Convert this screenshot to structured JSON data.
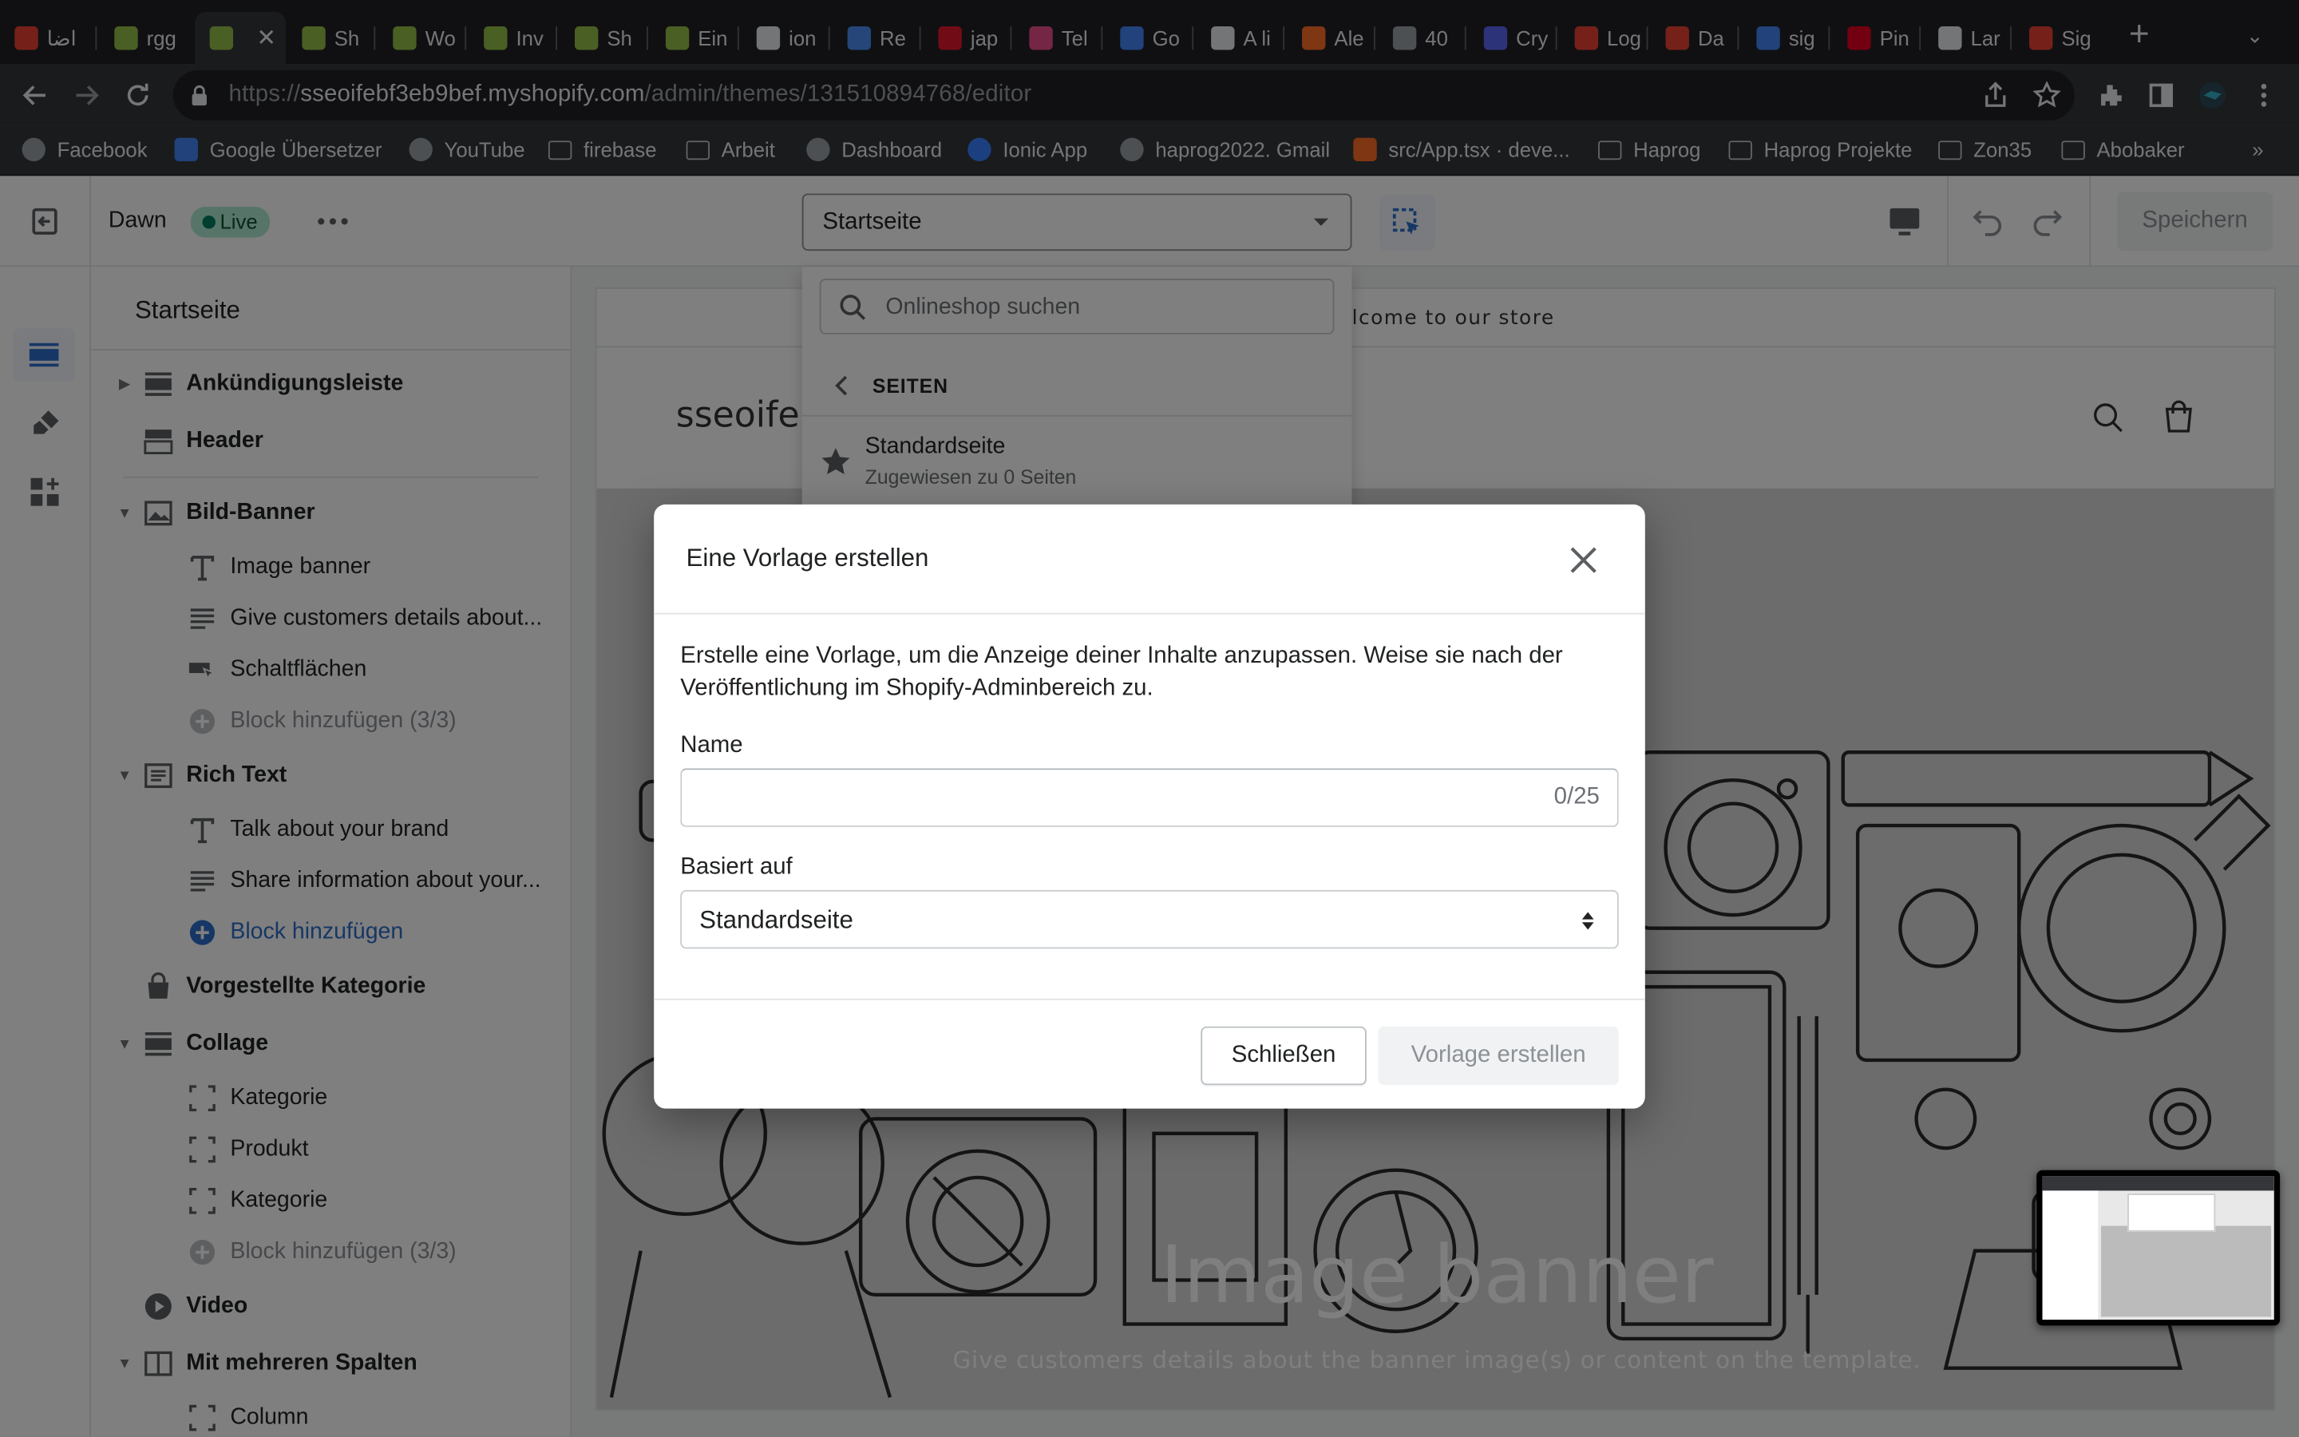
{
  "browser": {
    "tabs": [
      {
        "label": "اضا",
        "icon": "gmail-like-icon",
        "color": "#ea4335"
      },
      {
        "label": "rgg",
        "icon": "shopify-icon",
        "color": "#95bf47"
      },
      {
        "label": "",
        "icon": "shopify-icon",
        "color": "#95bf47",
        "active": true
      },
      {
        "label": "Sh",
        "icon": "shopify-icon",
        "color": "#95bf47"
      },
      {
        "label": "Wo",
        "icon": "shopify-icon",
        "color": "#95bf47"
      },
      {
        "label": "Inv",
        "icon": "shopify-icon",
        "color": "#95bf47"
      },
      {
        "label": "Sh",
        "icon": "shopify-icon",
        "color": "#95bf47"
      },
      {
        "label": "Ein",
        "icon": "shopify-icon",
        "color": "#95bf47"
      },
      {
        "label": "ion",
        "icon": "github-icon",
        "color": "#e8eaed"
      },
      {
        "label": "Re",
        "icon": "redux-icon",
        "color": "#4c8df5"
      },
      {
        "label": "jap",
        "icon": "notion-red-icon",
        "color": "#e2192c"
      },
      {
        "label": "Tel",
        "icon": "dribbble-icon",
        "color": "#ea4c89"
      },
      {
        "label": "Go",
        "icon": "google-translate-icon",
        "color": "#4285f4"
      },
      {
        "label": "A li",
        "icon": "github-icon",
        "color": "#e8eaed"
      },
      {
        "label": "Ale",
        "icon": "gitlab-icon",
        "color": "#fc6d26"
      },
      {
        "label": "40",
        "icon": "globe-icon",
        "color": "#9aa0a6"
      },
      {
        "label": "Cry",
        "icon": "crypto-icon",
        "color": "#5a67f2"
      },
      {
        "label": "Log",
        "icon": "app-red-icon",
        "color": "#ea4335"
      },
      {
        "label": "Da",
        "icon": "app-red-icon",
        "color": "#ea4335"
      },
      {
        "label": "sig",
        "icon": "google-icon",
        "color": "#4285f4"
      },
      {
        "label": "Pin",
        "icon": "pinterest-icon",
        "color": "#e60023"
      },
      {
        "label": "Lar",
        "icon": "target-icon",
        "color": "#e8eaed"
      },
      {
        "label": "Sig",
        "icon": "app-red-icon",
        "color": "#ea4335"
      }
    ],
    "url_host": "sseoifebf3eb9bef.myshopify.com",
    "url_path": "/admin/themes/131510894768/editor",
    "url_scheme": "https://",
    "bookmarks": [
      {
        "label": "Facebook",
        "icon": "globe"
      },
      {
        "label": "Google Übersetzer",
        "icon": "translate"
      },
      {
        "label": "YouTube",
        "icon": "globe"
      },
      {
        "label": "firebase",
        "icon": "folder"
      },
      {
        "label": "Arbeit",
        "icon": "folder"
      },
      {
        "label": "Dashboard",
        "icon": "globe"
      },
      {
        "label": "Ionic App",
        "icon": "ionic"
      },
      {
        "label": "haprog2022. Gmail",
        "icon": "globe"
      },
      {
        "label": "src/App.tsx · deve...",
        "icon": "gitlab"
      },
      {
        "label": "Haprog",
        "icon": "folder"
      },
      {
        "label": "Haprog Projekte",
        "icon": "folder"
      },
      {
        "label": "Zon35",
        "icon": "folder"
      },
      {
        "label": "Abobaker",
        "icon": "folder"
      }
    ],
    "bookmarks_more": "»"
  },
  "editor": {
    "theme_name": "Dawn",
    "live_badge": "Live",
    "page_select": "Startseite",
    "save_label": "Speichern",
    "sidebar_title": "Startseite",
    "tree": [
      {
        "type": "sec",
        "label": "Ankündigungsleiste",
        "icon": "section",
        "caret": "right"
      },
      {
        "type": "sec",
        "label": "Header",
        "icon": "header",
        "caret": ""
      },
      {
        "type": "sec",
        "label": "Bild-Banner",
        "icon": "image",
        "caret": "down"
      },
      {
        "type": "blk",
        "label": "Image banner",
        "icon": "text-T"
      },
      {
        "type": "blk",
        "label": "Give customers details about...",
        "icon": "lines"
      },
      {
        "type": "blk",
        "label": "Schaltflächen",
        "icon": "button"
      },
      {
        "type": "blk dim",
        "label": "Block hinzufügen (3/3)",
        "icon": "plus-gray"
      },
      {
        "type": "sec",
        "label": "Rich Text",
        "icon": "richtext",
        "caret": "down"
      },
      {
        "type": "blk",
        "label": "Talk about your brand",
        "icon": "text-T"
      },
      {
        "type": "blk",
        "label": "Share information about your...",
        "icon": "lines"
      },
      {
        "type": "blk link",
        "label": "Block hinzufügen",
        "icon": "plus-blue"
      },
      {
        "type": "sec",
        "label": "Vorgestellte Kategorie",
        "icon": "collection",
        "caret": ""
      },
      {
        "type": "sec",
        "label": "Collage",
        "icon": "section",
        "caret": "down"
      },
      {
        "type": "blk",
        "label": "Kategorie",
        "icon": "frame"
      },
      {
        "type": "blk",
        "label": "Produkt",
        "icon": "frame"
      },
      {
        "type": "blk",
        "label": "Kategorie",
        "icon": "frame"
      },
      {
        "type": "blk dim",
        "label": "Block hinzufügen (3/3)",
        "icon": "plus-gray"
      },
      {
        "type": "sec",
        "label": "Video",
        "icon": "play",
        "caret": ""
      },
      {
        "type": "sec",
        "label": "Mit mehreren Spalten",
        "icon": "columns",
        "caret": "down"
      },
      {
        "type": "blk",
        "label": "Column",
        "icon": "frame"
      }
    ]
  },
  "dropdown": {
    "search_placeholder": "Onlineshop suchen",
    "back_label": "SEITEN",
    "item_title": "Standardseite",
    "item_sub": "Zugewiesen zu 0 Seiten"
  },
  "storefront": {
    "announcement": "Welcome to our store",
    "store_name": "sseoifebf3eb9bef",
    "banner_heading": "Image banner",
    "banner_text": "Give customers details about the banner image(s) or content on the template."
  },
  "modal": {
    "title": "Eine Vorlage erstellen",
    "description": "Erstelle eine Vorlage, um die Anzeige deiner Inhalte anzupassen. Weise sie nach der Veröffentlichung im Shopify-Adminbereich zu.",
    "name_label": "Name",
    "name_value": "",
    "name_counter": "0/25",
    "based_on_label": "Basiert auf",
    "based_on_value": "Standardseite",
    "close_label": "Schließen",
    "create_label": "Vorlage erstellen"
  }
}
